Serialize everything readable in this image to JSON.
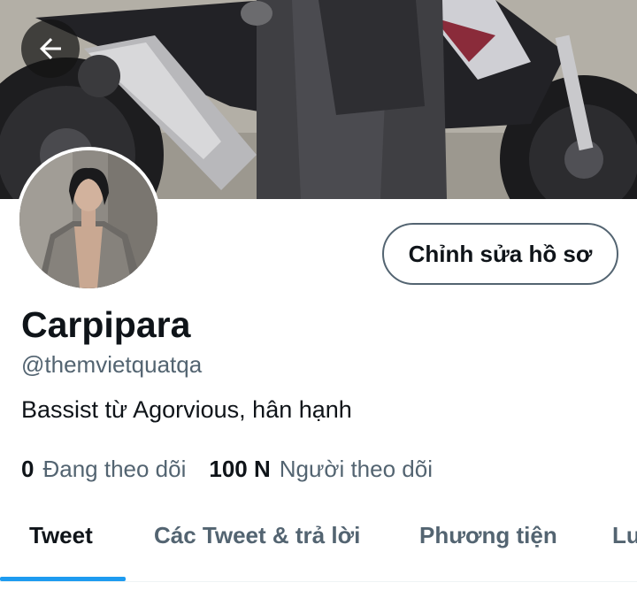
{
  "header": {
    "back_icon": "arrow-left-icon",
    "banner_description_icon": "banner-photo"
  },
  "profile": {
    "avatar_icon": "avatar-photo",
    "edit_button_label": "Chỉnh sửa hồ sơ",
    "display_name": "Carpipara",
    "handle": "@themvietquatqa",
    "bio": "Bassist từ Agorvious, hân hạnh",
    "following_count": "0",
    "following_label": "Đang theo dõi",
    "followers_count": "100 N",
    "followers_label": "Người theo dõi"
  },
  "tabs": [
    {
      "label": "Tweet",
      "active": true
    },
    {
      "label": "Các Tweet & trả lời",
      "active": false
    },
    {
      "label": "Phương tiện",
      "active": false
    },
    {
      "label": "Lư",
      "active": false
    }
  ],
  "colors": {
    "accent": "#1d9bf0",
    "text_primary": "#0f1419",
    "text_secondary": "#536471"
  }
}
